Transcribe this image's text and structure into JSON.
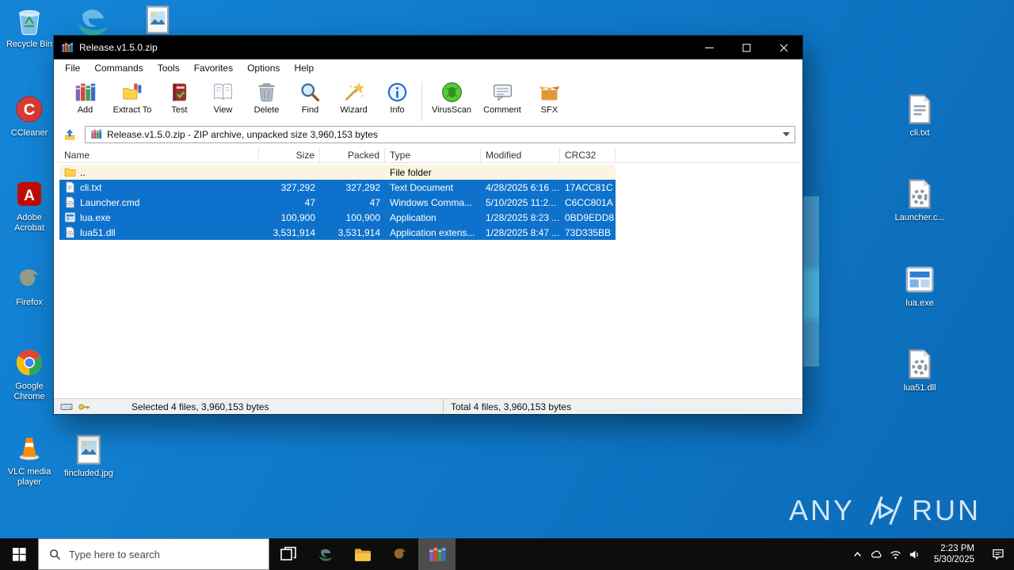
{
  "desktop": {
    "icons_left": [
      {
        "label": "Recycle Bin"
      },
      {
        "label": "CCleaner"
      },
      {
        "label": "Adobe Acrobat"
      },
      {
        "label": "Firefox"
      },
      {
        "label": "Google Chrome"
      },
      {
        "label": "VLC media player"
      }
    ],
    "icon_fincluded": {
      "label": "fincluded.jpg"
    },
    "icons_right": [
      {
        "label": "cli.txt"
      },
      {
        "label": "Launcher.c..."
      },
      {
        "label": "lua.exe"
      },
      {
        "label": "lua51.dll"
      }
    ],
    "watermark": {
      "word_left": "ANY",
      "word_right": "RUN"
    }
  },
  "winrar": {
    "title": "Release.v1.5.0.zip",
    "menu": [
      "File",
      "Commands",
      "Tools",
      "Favorites",
      "Options",
      "Help"
    ],
    "toolbar": [
      "Add",
      "Extract To",
      "Test",
      "View",
      "Delete",
      "Find",
      "Wizard",
      "Info",
      "VirusScan",
      "Comment",
      "SFX"
    ],
    "address_text": "Release.v1.5.0.zip - ZIP archive, unpacked size 3,960,153 bytes",
    "columns": [
      "Name",
      "Size",
      "Packed",
      "Type",
      "Modified",
      "CRC32"
    ],
    "rows": [
      {
        "name": "..",
        "size": "",
        "packed": "",
        "type": "File folder",
        "modified": "",
        "crc32": ""
      },
      {
        "name": "cli.txt",
        "size": "327,292",
        "packed": "327,292",
        "type": "Text Document",
        "modified": "4/28/2025 6:16 ...",
        "crc32": "17ACC81C"
      },
      {
        "name": "Launcher.cmd",
        "size": "47",
        "packed": "47",
        "type": "Windows Comma...",
        "modified": "5/10/2025 11:2...",
        "crc32": "C6CC801A"
      },
      {
        "name": "lua.exe",
        "size": "100,900",
        "packed": "100,900",
        "type": "Application",
        "modified": "1/28/2025 8:23 ...",
        "crc32": "0BD9EDD8"
      },
      {
        "name": "lua51.dll",
        "size": "3,531,914",
        "packed": "3,531,914",
        "type": "Application extens...",
        "modified": "1/28/2025 8:47 ...",
        "crc32": "73D335BB"
      }
    ],
    "status_selected": "Selected 4 files, 3,960,153 bytes",
    "status_total": "Total 4 files, 3,960,153 bytes"
  },
  "taskbar": {
    "search_placeholder": "Type here to search",
    "time": "2:23 PM",
    "date": "5/30/2025"
  }
}
